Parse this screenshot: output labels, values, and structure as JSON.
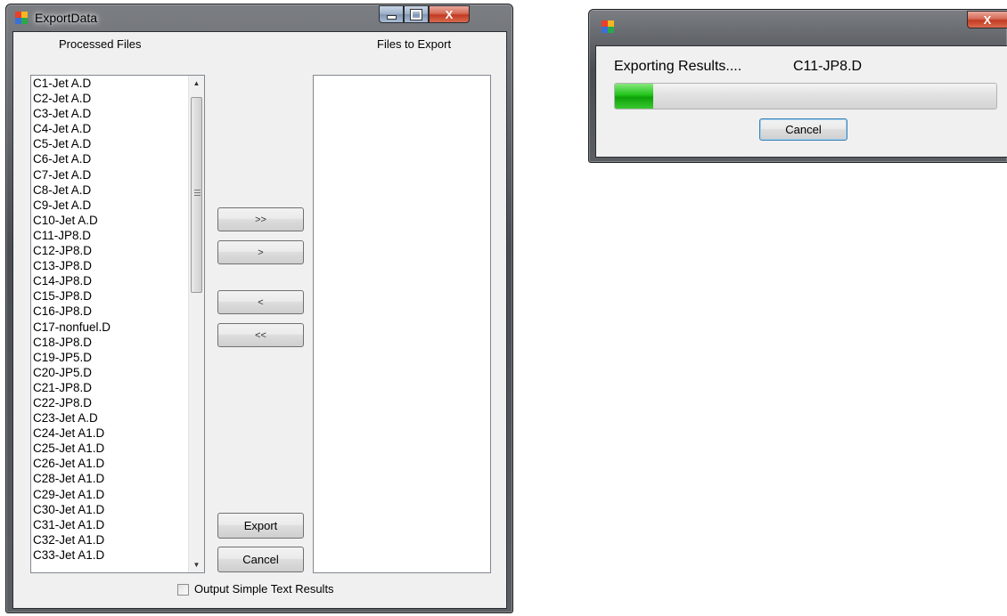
{
  "export_window": {
    "title": "ExportData",
    "caption_buttons": {
      "minimize": "—",
      "maximize": "☐",
      "close": "X"
    },
    "processed_files_label": "Processed Files",
    "files_to_export_label": "Files to Export",
    "processed_files": [
      "C1-Jet A.D",
      "C2-Jet A.D",
      "C3-Jet A.D",
      "C4-Jet A.D",
      "C5-Jet A.D",
      "C6-Jet A.D",
      "C7-Jet A.D",
      "C8-Jet A.D",
      "C9-Jet A.D",
      "C10-Jet A.D",
      "C11-JP8.D",
      "C12-JP8.D",
      "C13-JP8.D",
      "C14-JP8.D",
      "C15-JP8.D",
      "C16-JP8.D",
      "C17-nonfuel.D",
      "C18-JP8.D",
      "C19-JP5.D",
      "C20-JP5.D",
      "C21-JP8.D",
      "C22-JP8.D",
      "C23-Jet A.D",
      "C24-Jet A1.D",
      "C25-Jet A1.D",
      "C26-Jet A1.D",
      "C28-Jet A1.D",
      "C29-Jet A1.D",
      "C30-Jet A1.D",
      "C31-Jet A1.D",
      "C32-Jet A1.D",
      "C33-Jet A1.D"
    ],
    "files_to_export": [],
    "buttons": {
      "add_all": ">>",
      "add": ">",
      "remove": "<",
      "remove_all": "<<",
      "export": "Export",
      "cancel": "Cancel"
    },
    "checkbox_label": "Output Simple Text Results",
    "checkbox_checked": false,
    "scroll_icons": {
      "up": "▲",
      "down": "▼"
    }
  },
  "progress_window": {
    "title": "",
    "close": "X",
    "status_label": "Exporting Results....",
    "current_file": "C11-JP8.D",
    "progress_fraction": 0.1,
    "cancel_label": "Cancel"
  },
  "colors": {
    "app_icon": [
      "#e8402a",
      "#f6b622",
      "#3b6fd6",
      "#2aa84a"
    ],
    "progress_green": "#22c41a"
  }
}
